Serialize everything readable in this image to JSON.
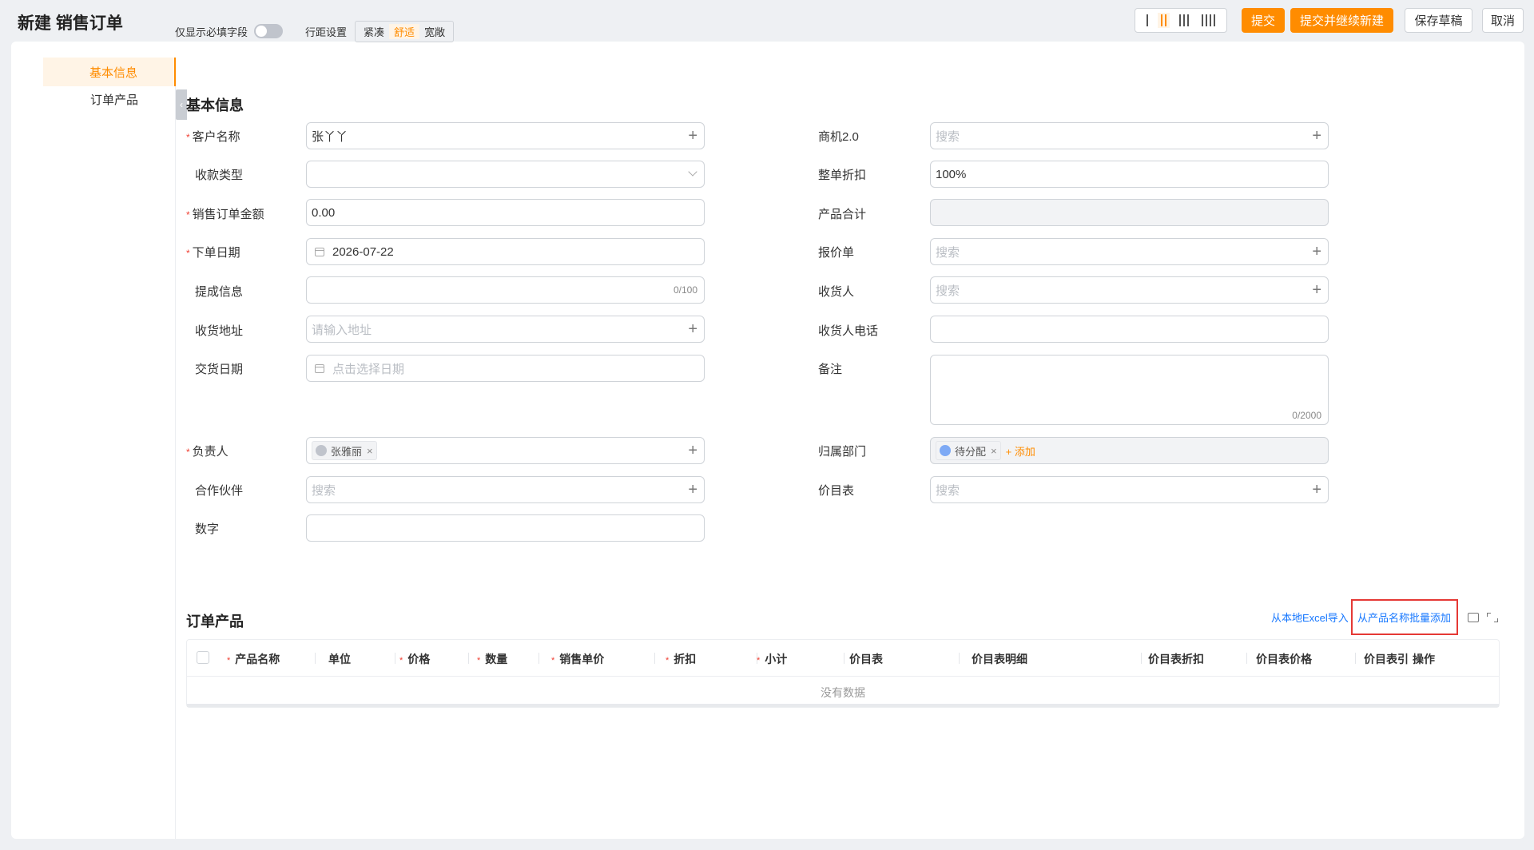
{
  "page": {
    "title": "新建 销售订单"
  },
  "header": {
    "submit": "提交",
    "submit_and_new": "提交并继续新建",
    "save_draft": "保存草稿",
    "cancel": "取消"
  },
  "sidebar": {
    "items": [
      {
        "label": "基本信息",
        "active": true
      },
      {
        "label": "订单产品",
        "active": false
      }
    ]
  },
  "options": {
    "required_only_label": "仅显示必填字段",
    "density_label": "行距设置",
    "density_options": [
      "紧凑",
      "舒适",
      "宽敞"
    ],
    "density_selected": "舒适"
  },
  "basic_info": {
    "title": "基本信息",
    "left": {
      "customer": {
        "label": "客户名称",
        "value": "张丫丫"
      },
      "payment_type": {
        "label": "收款类型",
        "value": ""
      },
      "amount": {
        "label": "销售订单金额",
        "value": "0.00"
      },
      "order_date": {
        "label": "下单日期",
        "value": "2026-07-22"
      },
      "commission": {
        "label": "提成信息",
        "counter": "0/100"
      },
      "address": {
        "label": "收货地址",
        "placeholder": "请输入地址"
      },
      "delivery_date": {
        "label": "交货日期",
        "placeholder": "点击选择日期"
      },
      "owner": {
        "label": "负责人",
        "tag": "张雅丽"
      },
      "partner": {
        "label": "合作伙伴",
        "placeholder": "搜索"
      },
      "number": {
        "label": "数字",
        "value": ""
      }
    },
    "right": {
      "opportunity": {
        "label": "商机2.0",
        "placeholder": "搜索"
      },
      "discount": {
        "label": "整单折扣",
        "value": "100%"
      },
      "product_total": {
        "label": "产品合计",
        "value": ""
      },
      "quote": {
        "label": "报价单",
        "placeholder": "搜索"
      },
      "receiver": {
        "label": "收货人",
        "placeholder": "搜索"
      },
      "receiver_phone": {
        "label": "收货人电话",
        "value": ""
      },
      "remark": {
        "label": "备注",
        "counter": "0/2000"
      },
      "department": {
        "label": "归属部门",
        "tag": "待分配",
        "add": "+ 添加"
      },
      "price_list": {
        "label": "价目表",
        "placeholder": "搜索"
      }
    }
  },
  "order_products": {
    "title": "订单产品",
    "import_excel": "从本地Excel导入",
    "batch_add": "从产品名称批量添加",
    "columns": [
      "产品名称",
      "单位",
      "价格",
      "数量",
      "销售单价",
      "折扣",
      "小计",
      "价目表",
      "价目表明细",
      "价目表折扣",
      "价目表价格",
      "价目表引",
      "操作"
    ],
    "empty_text": "没有数据"
  }
}
